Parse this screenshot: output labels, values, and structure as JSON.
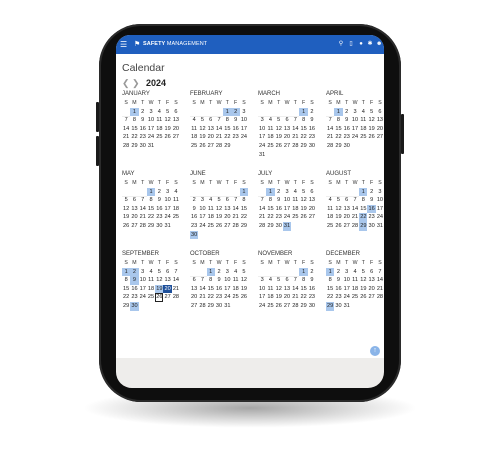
{
  "app": {
    "brand_bold": "SAFETY",
    "brand_rest": "MANAGEMENT",
    "icons": [
      "menu-icon",
      "logo-icon",
      "search-icon",
      "phone-icon",
      "notification-icon",
      "settings-icon",
      "user-icon"
    ]
  },
  "page": {
    "title": "Calendar",
    "prev_label": "❮",
    "next_label": "❯",
    "year": "2024",
    "weekday_labels": [
      "S",
      "M",
      "T",
      "W",
      "T",
      "F",
      "S"
    ],
    "fab_label": "↑"
  },
  "months": [
    {
      "name": "JANUARY",
      "offset": 1,
      "days": 31,
      "highlight": [
        1
      ]
    },
    {
      "name": "FEBRUARY",
      "offset": 4,
      "days": 29,
      "highlight": [
        1,
        2
      ]
    },
    {
      "name": "MARCH",
      "offset": 5,
      "days": 31,
      "highlight": [
        1
      ]
    },
    {
      "name": "APRIL",
      "offset": 1,
      "days": 30,
      "highlight": [
        1
      ]
    },
    {
      "name": "MAY",
      "offset": 3,
      "days": 31,
      "highlight": [
        1
      ]
    },
    {
      "name": "JUNE",
      "offset": 6,
      "days": 30,
      "highlight": [
        1,
        30
      ]
    },
    {
      "name": "JULY",
      "offset": 1,
      "days": 31,
      "highlight": [
        1,
        31
      ]
    },
    {
      "name": "AUGUST",
      "offset": 4,
      "days": 31,
      "highlight": [
        1,
        16,
        22,
        29
      ]
    },
    {
      "name": "SEPTEMBER",
      "offset": 0,
      "days": 30,
      "highlight": [
        1,
        2,
        9,
        19,
        30
      ],
      "dark": [
        20
      ],
      "today": [
        26
      ]
    },
    {
      "name": "OCTOBER",
      "offset": 2,
      "days": 31,
      "highlight": [
        1
      ]
    },
    {
      "name": "NOVEMBER",
      "offset": 5,
      "days": 30,
      "highlight": [
        1
      ]
    },
    {
      "name": "DECEMBER",
      "offset": 0,
      "days": 31,
      "highlight": [
        1,
        29
      ]
    }
  ]
}
